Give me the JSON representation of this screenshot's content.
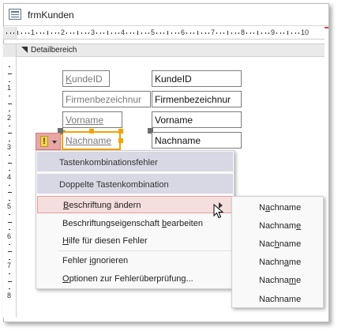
{
  "window": {
    "title": "frmKunden"
  },
  "ruler": {
    "h_numbers": [
      "1",
      "2",
      "3",
      "4",
      "5",
      "6",
      "7",
      "8",
      "9",
      "10"
    ],
    "v_numbers": [
      "1",
      "2",
      "3",
      "4",
      "5",
      "6",
      "7",
      "8"
    ]
  },
  "section": {
    "label": "Detailbereich"
  },
  "controls": [
    {
      "label": "KundeID",
      "label_underline": "K",
      "label_rest": "undeID",
      "field": "KundeID"
    },
    {
      "label": "Firmenbezeichnung",
      "label_underline": "",
      "label_rest": "Firmenbezeichnur",
      "field": "Firmenbezeichnur"
    },
    {
      "label": "Vorname",
      "label_underline": "Vorname",
      "label_rest": "",
      "field": "Vorname"
    },
    {
      "label": "Nachname",
      "label_underline": "Nachname",
      "label_rest": "",
      "field": "Nachname"
    }
  ],
  "error_indicator": {
    "symbol": "!"
  },
  "context_menu": {
    "headers": [
      "Tastenkombinationsfehler",
      "Doppelte Tastenkombination"
    ],
    "items": [
      {
        "pre": "",
        "u": "B",
        "post": "eschriftung ändern"
      },
      {
        "pre": "Beschriftungseigenschaft ",
        "u": "b",
        "post": "earbeiten"
      },
      {
        "pre": "",
        "u": "H",
        "post": "ilfe für diesen Fehler"
      },
      {
        "pre": "Fehler ",
        "u": "i",
        "post": "gnorieren"
      },
      {
        "pre": "",
        "u": "O",
        "post": "ptionen zur Fehlerüberprüfung..."
      }
    ]
  },
  "submenu": {
    "items": [
      {
        "pre": "N",
        "u": "a",
        "post": "chname"
      },
      {
        "pre": "Nachnam",
        "u": "e",
        "post": ""
      },
      {
        "pre": "Nac",
        "u": "h",
        "post": "name"
      },
      {
        "pre": "Nachn",
        "u": "a",
        "post": "me"
      },
      {
        "pre": "Nachna",
        "u": "m",
        "post": "e"
      },
      {
        "pre": "Nachname",
        "u": "",
        "post": ""
      }
    ]
  },
  "colors": {
    "accent_red": "#c34b4b",
    "selection_orange": "#f7a200",
    "menu_header": "#d8d7e4",
    "menu_active": "#f4dede"
  }
}
